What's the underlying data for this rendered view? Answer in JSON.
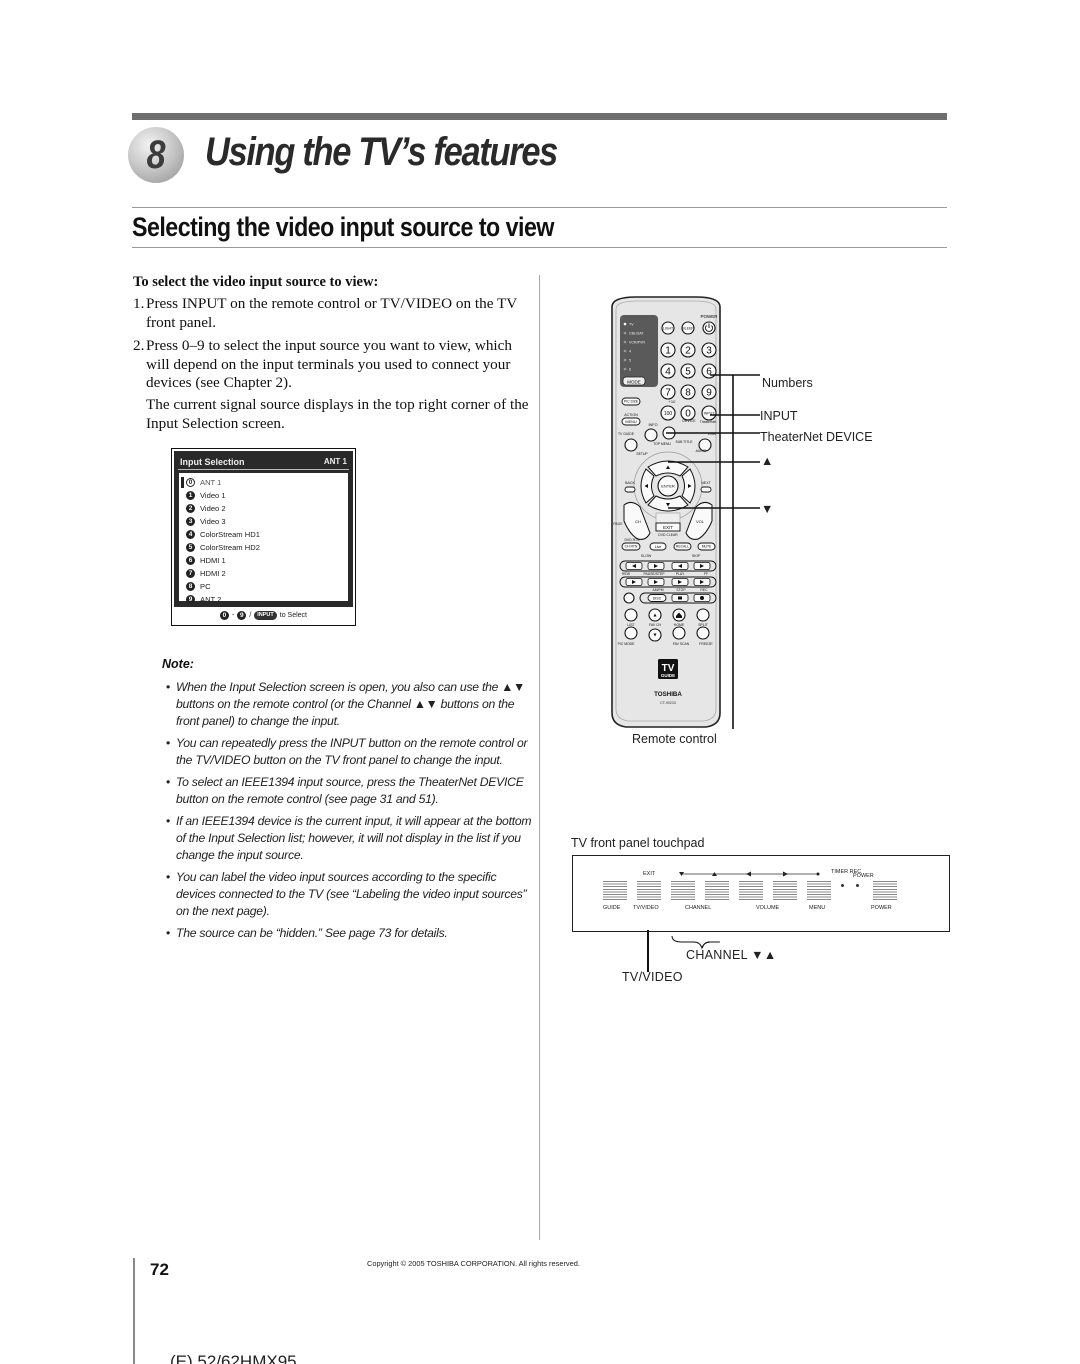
{
  "chapter": {
    "number": "8",
    "title": "Using the TV’s features"
  },
  "section": {
    "title": "Selecting the video input source to view"
  },
  "procedure": {
    "heading": "To select the video input source to view:",
    "steps": [
      {
        "num": "1.",
        "text": "Press INPUT on the remote control or TV/VIDEO on the TV front panel."
      },
      {
        "num": "2.",
        "text": "Press 0–9 to select the input source you want to view, which will depend on the input terminals you used to connect your devices (see Chapter 2)."
      }
    ],
    "followup": "The current signal source displays in the top right corner of the Input Selection screen."
  },
  "input_selection_screen": {
    "title": "Input Selection",
    "current_source": "ANT 1",
    "items": [
      {
        "key": "0",
        "label": "ANT 1",
        "selected": true
      },
      {
        "key": "1",
        "label": "Video 1"
      },
      {
        "key": "2",
        "label": "Video 2"
      },
      {
        "key": "3",
        "label": "Video 3"
      },
      {
        "key": "4",
        "label": "ColorStream HD1"
      },
      {
        "key": "5",
        "label": "ColorStream HD2"
      },
      {
        "key": "6",
        "label": "HDMI 1"
      },
      {
        "key": "7",
        "label": "HDMI 2"
      },
      {
        "key": "8",
        "label": "PC"
      },
      {
        "key": "9",
        "label": "ANT 2"
      }
    ],
    "footer": {
      "from_key": "0",
      "dash": "-",
      "to_key": "9",
      "slash": "/",
      "input_button": "INPUT",
      "text": "to Select"
    }
  },
  "notes": {
    "heading": "Note:",
    "bullet": "•",
    "items": [
      "When the Input Selection screen is open, you also can use the ▲▼ buttons on the remote control (or the Channel ▲▼ buttons on the front panel) to change the input.",
      "You can repeatedly press the INPUT button on the remote control or the TV/VIDEO button on the TV front panel to change the input.",
      "To select an IEEE1394 input source, press the TheaterNet DEVICE button on the remote control (see page 31 and 51).",
      "If an IEEE1394 device is the current input, it will appear at the bottom of the Input Selection list; however, it will not display in the list if you change the input source.",
      "You can label the video input sources according to the specific devices connected to the TV (see “Labeling the video input sources” on the next page).",
      "The source can be “hidden.” See page 73 for details."
    ]
  },
  "remote": {
    "caption": "Remote control",
    "callouts": {
      "numbers": "Numbers",
      "input": "INPUT",
      "device": "TheaterNet DEVICE",
      "up": "▲",
      "down": "▼"
    },
    "labels": {
      "power": "POWER",
      "light": "LIGHT",
      "sleep": "SLEEP",
      "mode": "MODE",
      "modes": [
        "TV",
        "CBL/SAT",
        "VCR/PVR",
        "4",
        "5",
        "6"
      ],
      "digits": [
        "1",
        "2",
        "3",
        "4",
        "5",
        "6",
        "7",
        "8",
        "9"
      ],
      "pic_size": "PIC SIZE",
      "plus10": "+10",
      "hundred": "100",
      "zero": "0",
      "input": "INPUT",
      "action_menu": "ACTION",
      "menu": "MENU",
      "info": "INFO",
      "device": "DEVICE",
      "theaternet": "TheaterNet",
      "link": "LINK",
      "tv_guide": "TV GUIDE",
      "setup": "SETUP",
      "top_menu": "TOP MENU",
      "sub_title": "SUB TITLE",
      "audio": "AUDIO",
      "enter": "ENTER",
      "back": "BACK",
      "next": "NEXT",
      "ch": "CH",
      "vol": "VOL",
      "page": "PAGE",
      "exit": "EXIT",
      "dvd_clear": "DVD CLEAR",
      "dvd_rtn": "DVD RTN",
      "ch_rtn": "CH RTN",
      "live": "Live",
      "recall": "RECALL",
      "mute": "MUTE",
      "slow": "SLOW",
      "skip": "SKIP",
      "rew": "REW",
      "pause_step": "PAUSE/STEP",
      "play": "PLAY",
      "ff": "FF",
      "am_pm": "AM/PM",
      "stop": "STOP",
      "rec": "REC",
      "disc": "DISC",
      "list": "LIST",
      "fav_ch": "FAV CH",
      "home": "HOME",
      "split": "SPLIT",
      "pic_mode": "PIC MODE",
      "fav_scan": "FAV SCAN",
      "freeze": "FREEZE",
      "tv_guide_logo_top": "TV",
      "tv_guide_logo_bottom": "GUIDE",
      "brand": "TOSHIBA",
      "model": "CT-90233"
    }
  },
  "front_panel": {
    "caption": "TV front panel touchpad",
    "top_labels": {
      "exit": "EXIT",
      "timer_rec": "TIMER REC",
      "power_led": "POWER"
    },
    "buttons": [
      "GUIDE",
      "TV/VIDEO",
      "CHANNEL",
      "VOLUME",
      "MENU",
      "POWER"
    ],
    "callouts": {
      "channel": "CHANNEL ▼▲",
      "tv_video": "TV/VIDEO"
    }
  },
  "footer": {
    "page_number": "72",
    "copyright": "Copyright © 2005 TOSHIBA CORPORATION. All rights reserved.",
    "model_code": "(E) 52/62HMX95"
  }
}
